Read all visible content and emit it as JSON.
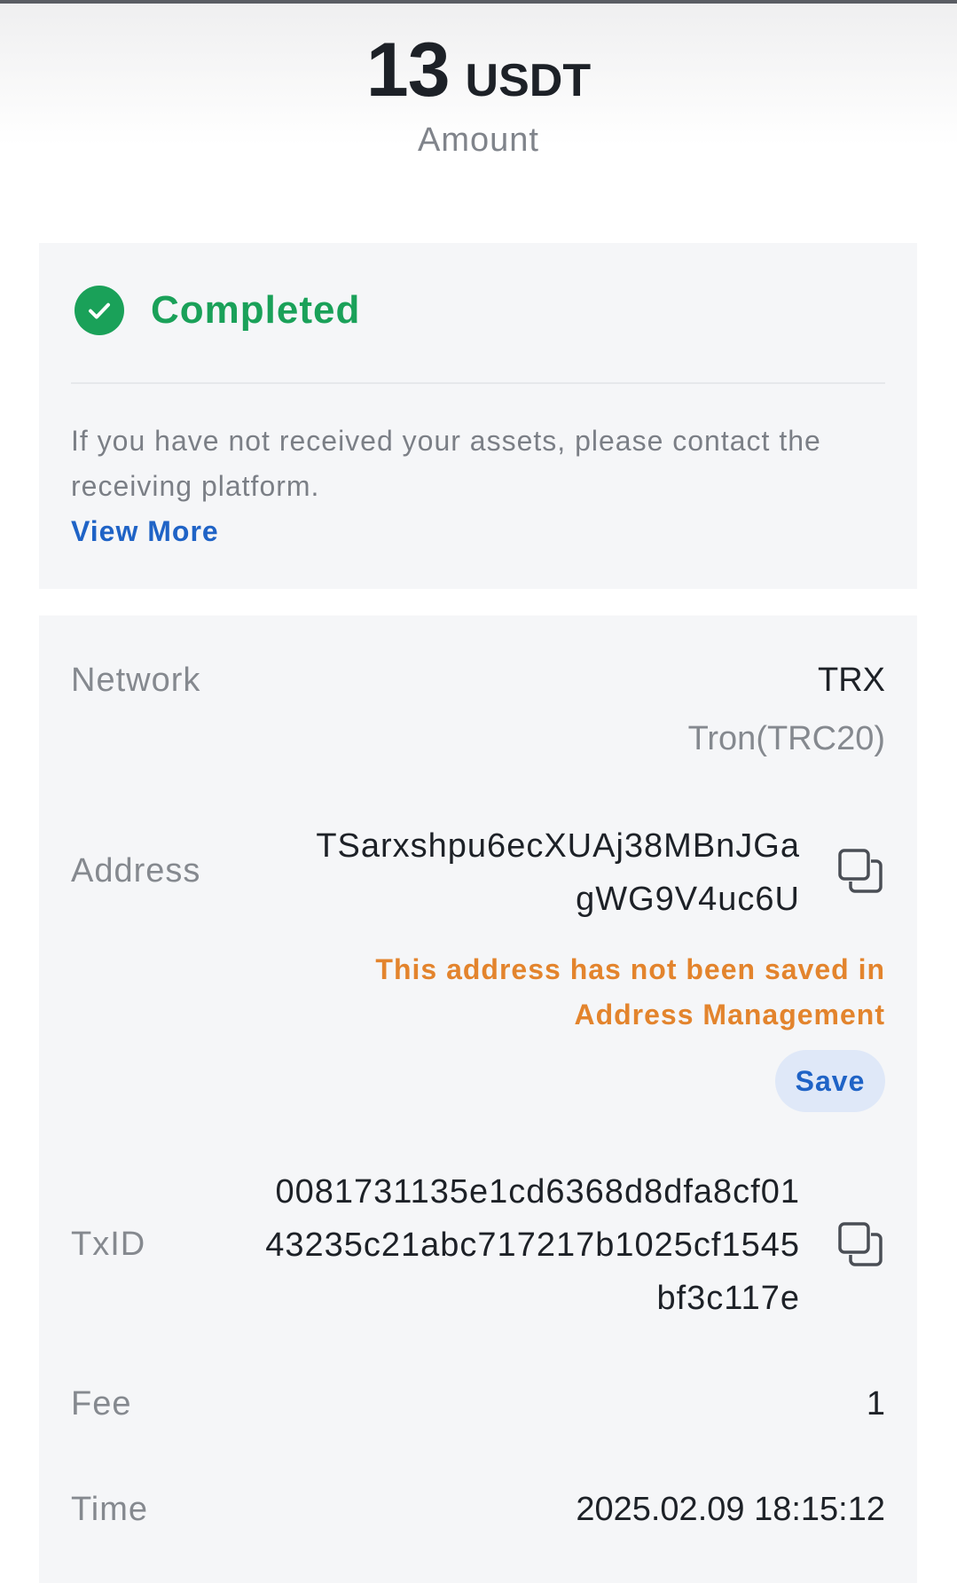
{
  "header": {
    "amount_value": "13",
    "amount_unit": "USDT",
    "amount_caption": "Amount"
  },
  "status": {
    "icon": "check-circle-icon",
    "text": "Completed",
    "color": "#1aa159",
    "notice": "If you have not received your assets, please contact the receiving platform.",
    "view_more": "View More"
  },
  "details": {
    "network": {
      "label": "Network",
      "value": "TRX",
      "sub_value": "Tron(TRC20)"
    },
    "address": {
      "label": "Address",
      "line1": "TSarxshpu6ecXUAj38MBnJGa",
      "line2": "gWG9V4uc6U",
      "copy_icon": "copy-icon",
      "warning": "This address has not been saved in Address Management",
      "save_label": "Save"
    },
    "txid": {
      "label": "TxID",
      "line1": "0081731135e1cd6368d8dfa8cf01",
      "line2": "43235c21abc717217b1025cf1545",
      "line3": "bf3c117e",
      "copy_icon": "copy-icon"
    },
    "fee": {
      "label": "Fee",
      "value": "1"
    },
    "time": {
      "label": "Time",
      "value": "2025.02.09 18:15:12"
    }
  },
  "colors": {
    "accent": "#1f63c6",
    "success": "#1aa159",
    "warning": "#e3842d",
    "card_background": "#f5f6f8"
  }
}
